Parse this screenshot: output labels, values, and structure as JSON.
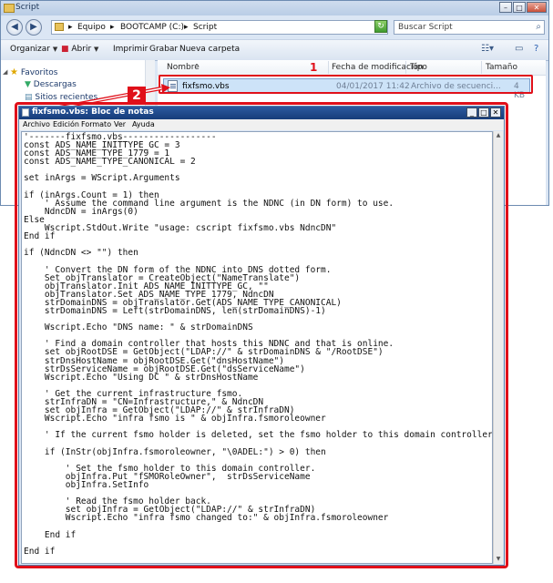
{
  "explorer": {
    "window_title": "Script",
    "address": {
      "crumbs": [
        "Equipo",
        "BOOTCAMP (C:)",
        "Script"
      ],
      "separators": [
        "▸",
        "▸",
        "▸"
      ]
    },
    "search_placeholder": "Buscar Script",
    "toolbar": {
      "organize": "Organizar",
      "open": "Abrir",
      "print": "Imprimir",
      "burn": "Grabar",
      "new_folder": "Nueva carpeta"
    },
    "nav": {
      "favorites": "Favoritos",
      "downloads": "Descargas",
      "recent": "Sitios recientes"
    },
    "columns": {
      "name": "Nombre",
      "modified": "Fecha de modificación",
      "type": "Tipo",
      "size": "Tamaño"
    },
    "files": [
      {
        "name": "fixfsmo.vbs",
        "modified": "04/01/2017 11:42",
        "type": "Archivo de secuenci...",
        "size": "4 KB"
      }
    ]
  },
  "annotations": {
    "label_1": "1",
    "label_2": "2",
    "color": "#e0101a"
  },
  "notepad": {
    "title": "fixfsmo.vbs: Bloc de notas",
    "menu": [
      "Archivo",
      "Edición",
      "Formato",
      "Ver",
      "Ayuda"
    ],
    "content": "'-------fixfsmo.vbs------------------\nconst ADS_NAME_INITTYPE_GC = 3\nconst ADS_NAME_TYPE_1779 = 1\nconst ADS_NAME_TYPE_CANONICAL = 2\n\nset inArgs = WScript.Arguments\n\nif (inArgs.Count = 1) then\n    ' Assume the command line argument is the NDNC (in DN form) to use.\n    NdncDN = inArgs(0)\nElse\n    Wscript.StdOut.Write \"usage: cscript fixfsmo.vbs NdncDN\"\nEnd if\n\nif (NdncDN <> \"\") then\n\n    ' Convert the DN form of the NDNC into DNS dotted form.\n    Set objTranslator = CreateObject(\"NameTranslate\")\n    objTranslator.Init ADS_NAME_INITTYPE_GC, \"\"\n    objTranslator.Set ADS_NAME_TYPE_1779, NdncDN\n    strDomainDNS = objTranslator.Get(ADS_NAME_TYPE_CANONICAL)\n    strDomainDNS = Left(strDomainDNS, len(strDomainDNS)-1)\n\n    Wscript.Echo \"DNS name: \" & strDomainDNS\n\n    ' Find a domain controller that hosts this NDNC and that is online.\n    set objRootDSE = GetObject(\"LDAP://\" & strDomainDNS & \"/RootDSE\")\n    strDnsHostName = objRootDSE.Get(\"dnsHostName\")\n    strDsServiceName = objRootDSE.Get(\"dsServiceName\")\n    Wscript.Echo \"Using DC \" & strDnsHostName\n\n    ' Get the current infrastructure fsmo.\n    strInfraDN = \"CN=Infrastructure,\" & NdncDN\n    set objInfra = GetObject(\"LDAP://\" & strInfraDN)\n    Wscript.Echo \"infra fsmo is \" & objInfra.fsmoroleowner\n\n    ' If the current fsmo holder is deleted, set the fsmo holder to this domain controller.\n\n    if (InStr(objInfra.fsmoroleowner, \"\\0ADEL:\") > 0) then\n\n        ' Set the fsmo holder to this domain controller.\n        objInfra.Put \"fSMORoleOwner\",  strDsServiceName\n        objInfra.SetInfo\n\n        ' Read the fsmo holder back.\n        set objInfra = GetObject(\"LDAP://\" & strInfraDN)\n        Wscript.Echo \"infra fsmo changed to:\" & objInfra.fsmoroleowner\n\n    End if\n\nEnd if"
  }
}
